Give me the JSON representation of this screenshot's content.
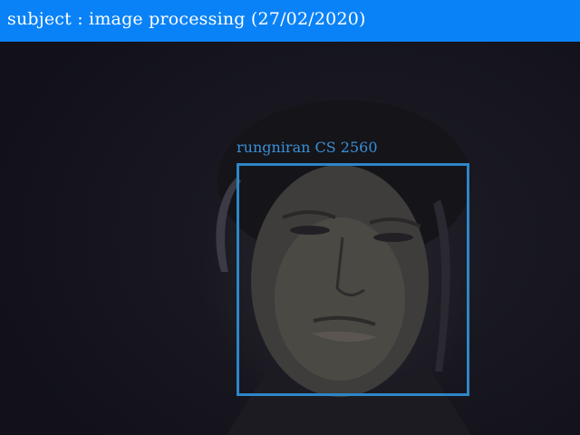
{
  "header": {
    "title": "subject : image processing (27/02/2020)"
  },
  "detection": {
    "label": "rungniran CS 2560"
  },
  "colors": {
    "header_background": "#0a82f7",
    "header_text": "#ffffff",
    "detection_box": "#2e86c8",
    "detection_label": "#3a8fd6"
  }
}
